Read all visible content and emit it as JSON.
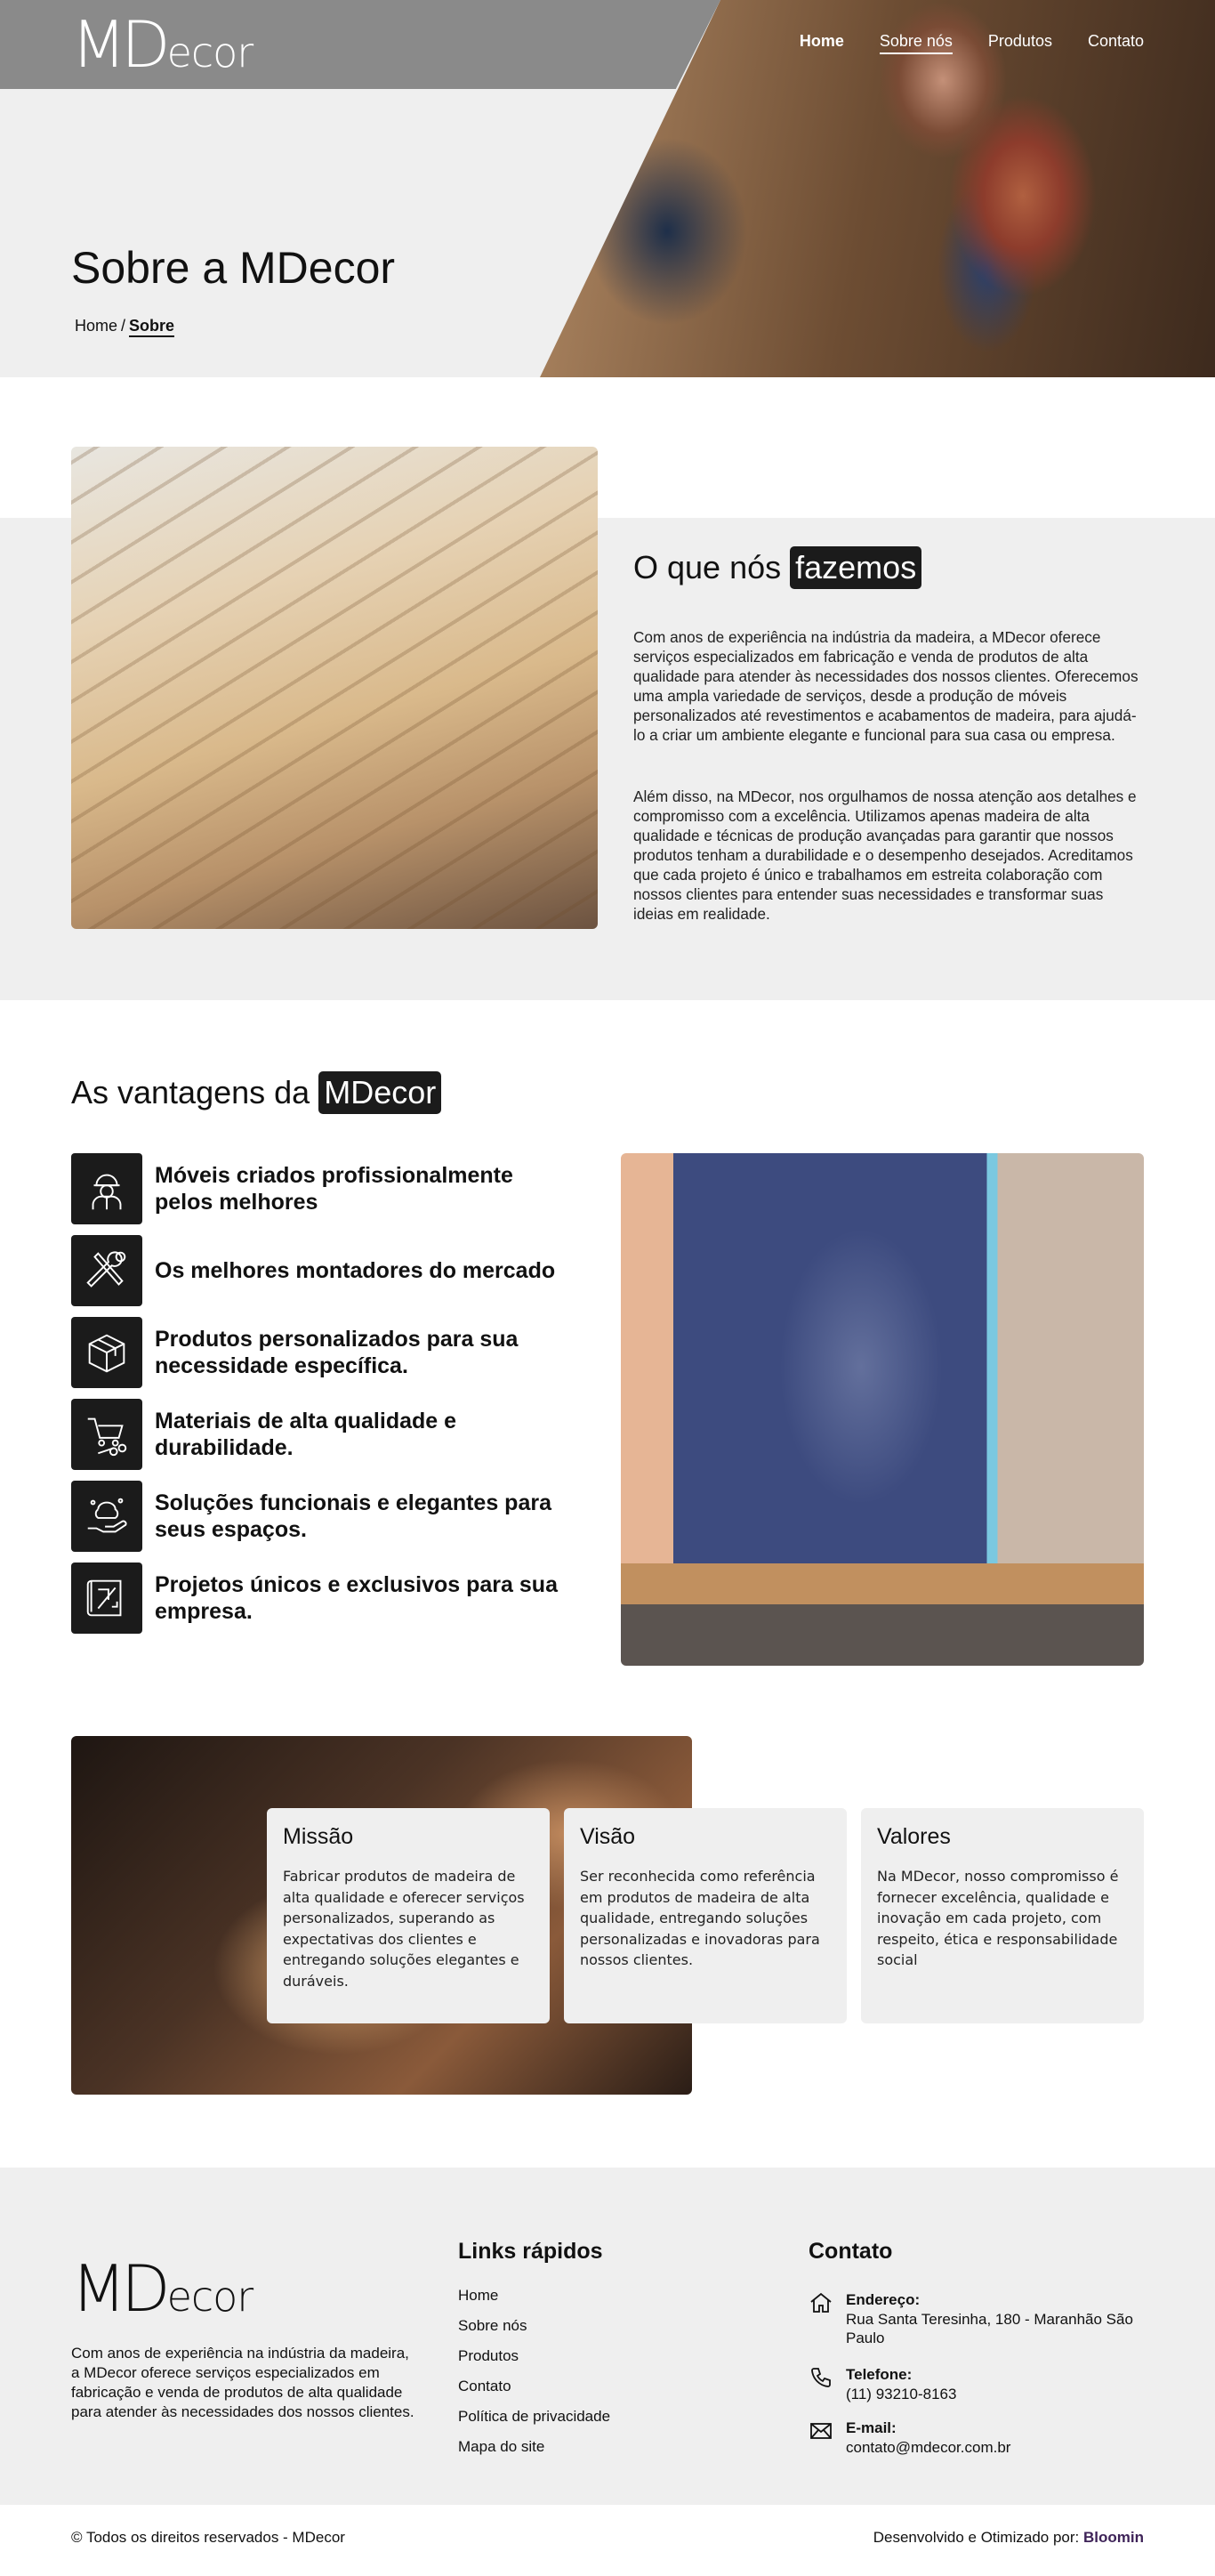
{
  "brand": {
    "logo_big": "MD",
    "logo_small": "ecor"
  },
  "nav": [
    {
      "label": "Home"
    },
    {
      "label": "Sobre nós"
    },
    {
      "label": "Produtos"
    },
    {
      "label": "Contato"
    }
  ],
  "hero": {
    "title": "Sobre a MDecor",
    "breadcrumb_home": "Home",
    "breadcrumb_sep": "/",
    "breadcrumb_current": "Sobre"
  },
  "whatwedo": {
    "title_plain": "O que nós",
    "title_tag": "fazemos",
    "p1": "Com anos de experiência na indústria da madeira, a MDecor oferece serviços especializados em fabricação e venda de produtos de alta qualidade para atender às necessidades dos nossos clientes. Oferecemos uma ampla variedade de serviços, desde a produção de móveis personalizados até revestimentos e acabamentos de madeira, para ajudá-lo a criar um ambiente elegante e funcional para sua casa ou empresa.",
    "p2": "Além disso, na MDecor, nos orgulhamos de nossa atenção aos detalhes e compromisso com a excelência. Utilizamos apenas madeira de alta qualidade e técnicas de produção avançadas para garantir que nossos produtos tenham a durabilidade e o desempenho desejados. Acreditamos que cada projeto é único e trabalhamos em estreita colaboração com nossos clientes para entender suas necessidades e transformar suas ideias em realidade."
  },
  "advantages": {
    "title_plain": "As vantagens da",
    "title_tag": "MDecor",
    "items": [
      {
        "icon": "worker-helmet-icon",
        "label": "Móveis criados profissionalmente pelos melhores"
      },
      {
        "icon": "tools-icon",
        "label": "Os melhores montadores do mercado"
      },
      {
        "icon": "package-box-icon",
        "label": "Produtos personalizados para sua necessidade específica."
      },
      {
        "icon": "cart-logs-icon",
        "label": "Materiais de alta qualidade e durabilidade."
      },
      {
        "icon": "hand-sparkle-icon",
        "label": "Soluções funcionais e elegantes para seus espaços."
      },
      {
        "icon": "blueprint-icon",
        "label": "Projetos únicos e exclusivos para sua empresa."
      }
    ]
  },
  "mvv": [
    {
      "title": "Missão",
      "text": "Fabricar produtos de madeira de alta qualidade e oferecer serviços personalizados, superando as expectativas dos clientes e entregando soluções elegantes e duráveis."
    },
    {
      "title": "Visão",
      "text": "Ser reconhecida como referência em produtos de madeira de alta qualidade, entregando soluções personalizadas e inovadoras para nossos clientes."
    },
    {
      "title": "Valores",
      "text": "Na MDecor, nosso compromisso é fornecer excelência, qualidade e inovação em cada projeto, com respeito, ética e responsabilidade social"
    }
  ],
  "footer": {
    "about": "Com anos de experiência na indústria da madeira, a MDecor oferece serviços especializados em fabricação e venda de produtos de alta qualidade para atender às necessidades dos nossos clientes.",
    "links_title": "Links rápidos",
    "links": [
      "Home",
      "Sobre nós",
      "Produtos",
      "Contato",
      "Política de privacidade",
      "Mapa do site"
    ],
    "contact_title": "Contato",
    "address_label": "Endereço:",
    "address": "Rua Santa Teresinha, 180 - Maranhão São Paulo",
    "phone_label": "Telefone:",
    "phone": "(11) 93210-8163",
    "email_label": "E-mail:",
    "email": "contato@mdecor.com.br",
    "copyright": "© Todos os direitos reservados - MDecor",
    "credit_text": "Desenvolvido e Otimizado por:",
    "credit_brand": "Bloomin"
  },
  "colors": {
    "dark": "#1b1b1b",
    "light_bg": "#efefef",
    "accent_credit": "#3e2358",
    "topbar": "#8a8a8a"
  }
}
